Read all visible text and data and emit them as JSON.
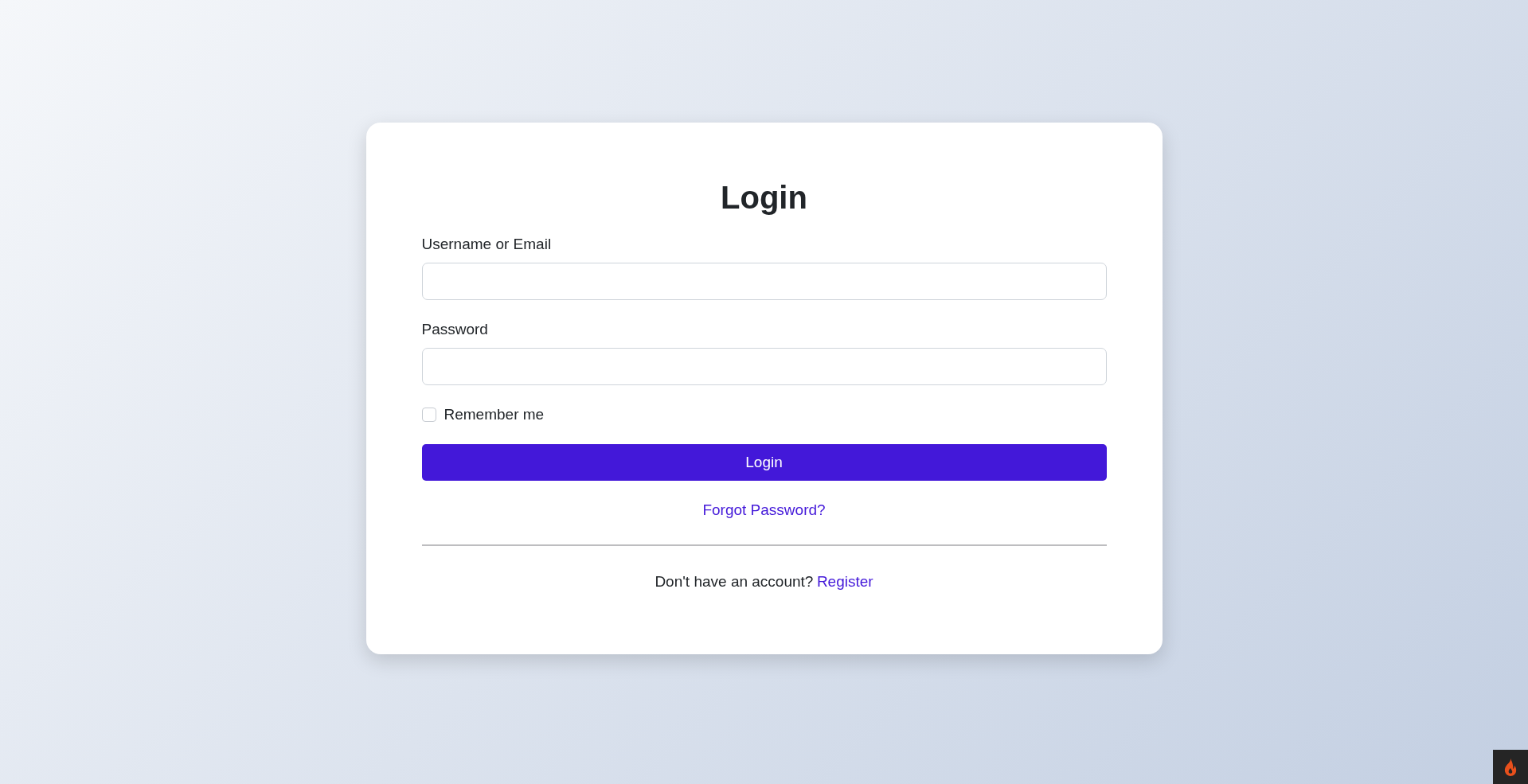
{
  "login_form": {
    "title": "Login",
    "fields": [
      {
        "label": "Username or Email"
      },
      {
        "label": "Password"
      }
    ],
    "remember_me": {
      "label": "Remember me",
      "checked": false
    },
    "submit_button": "Login",
    "forgot_link": "Forgot Password?",
    "register_prompt": "Don't have an account?",
    "register_link": "Register"
  }
}
